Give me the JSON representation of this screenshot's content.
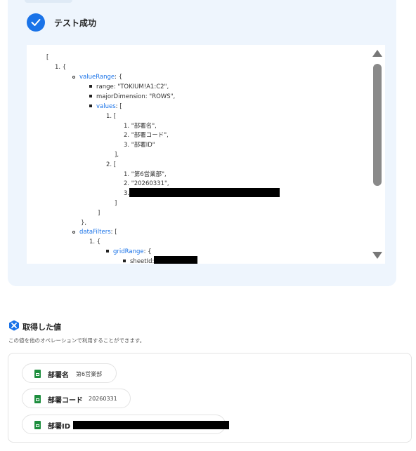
{
  "test_panel": {
    "title": "テスト成功",
    "code": {
      "open_bracket": "[",
      "item1_label": "1. {",
      "valueRange_key": "valueRange",
      "valueRange_suffix": ": {",
      "range_line": "range: \"TOKIUM!A1:C2\",",
      "majorDimension_line": "majorDimension: \"ROWS\",",
      "values_key": "values",
      "values_suffix": ": [",
      "row1_open": "1. [",
      "row1_values": [
        "1. \"部署名\",",
        "2. \"部署コード\",",
        "3. \"部署ID\""
      ],
      "row1_close": "],",
      "row2_open": "2. [",
      "row2_values": [
        "1. \"第6営業部\",",
        "2. \"20260331\","
      ],
      "row2_item3_prefix": "3.",
      "row2_close": "]",
      "values_close": "]",
      "valueRange_close": "},",
      "dataFilters_key": "dataFilters",
      "dataFilters_suffix": ": [",
      "df_item1": "1. {",
      "gridRange_key": "gridRange",
      "gridRange_suffix": ": {",
      "sheetId_prefix": "sheetId:"
    }
  },
  "acquired": {
    "title": "取得した値",
    "description": "この値を他のオペレーションで利用することができます。",
    "items": [
      {
        "label": "部署名",
        "value": "第6営業部"
      },
      {
        "label": "部署コード",
        "value": "20260331"
      },
      {
        "label": "部署ID",
        "value": ""
      }
    ]
  },
  "colors": {
    "accent": "#1a73e8",
    "panel_bg": "#eef5fd",
    "sheets_green": "#1e8e3e",
    "redaction": "#000000"
  },
  "icons": [
    "check-icon",
    "yoom-logo-icon",
    "google-sheets-icon",
    "scroll-up-arrow-icon",
    "scroll-down-arrow-icon"
  ]
}
